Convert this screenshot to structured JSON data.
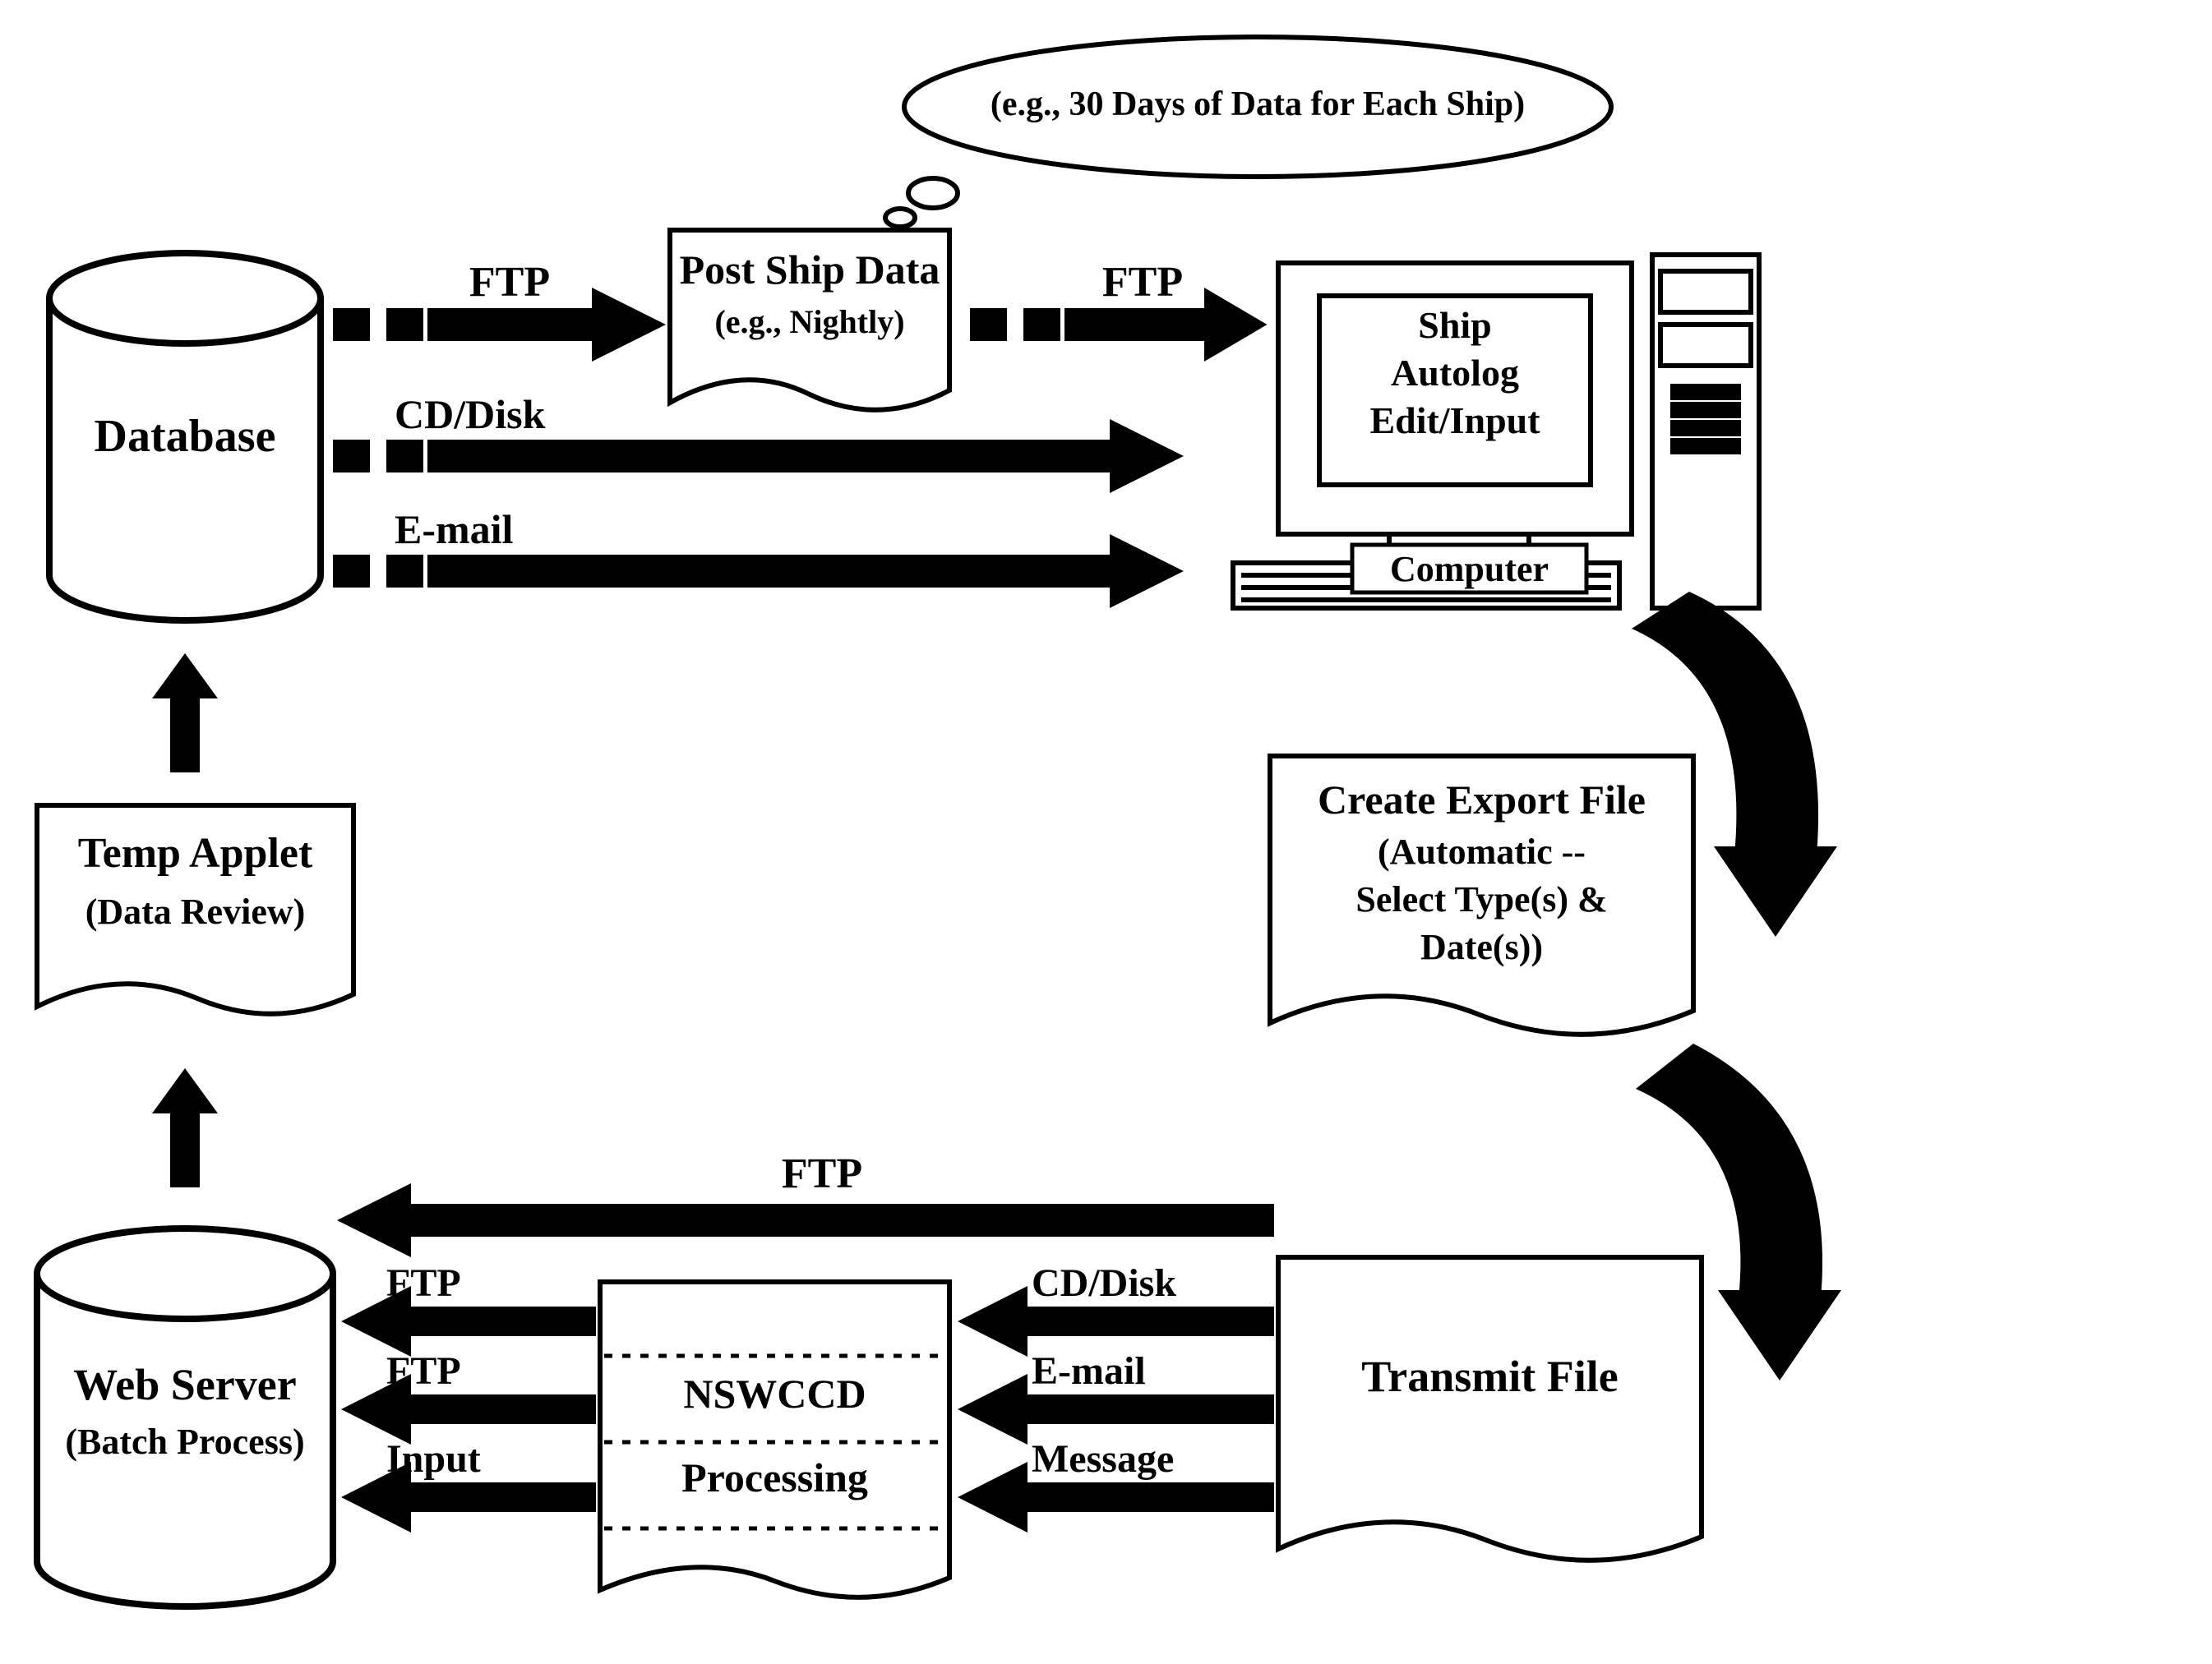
{
  "nodes": {
    "database": {
      "title": "Database"
    },
    "post_ship_data": {
      "title": "Post Ship Data",
      "subtitle": "(e.g., Nightly)"
    },
    "callout": {
      "text": "(e.g., 30 Days of Data for Each Ship)"
    },
    "ship_autolog": {
      "line1": "Ship",
      "line2": "Autolog",
      "line3": "Edit/Input"
    },
    "computer_label": {
      "text": "Computer"
    },
    "create_export": {
      "title": "Create Export  File",
      "line2": "(Automatic --",
      "line3": "Select Type(s) &",
      "line4": "Date(s))"
    },
    "transmit_file": {
      "title": "Transmit File"
    },
    "nswccd": {
      "line1": "NSWCCD",
      "line2": "Processing"
    },
    "web_server": {
      "title": "Web Server",
      "subtitle": "(Batch Process)"
    },
    "temp_applet": {
      "title": "Temp Applet",
      "subtitle": "(Data Review)"
    }
  },
  "edges": {
    "db_to_post_ftp": "FTP",
    "post_to_comp_ftp": "FTP",
    "db_to_comp_cd": "CD/Disk",
    "db_to_comp_email": "E-mail",
    "transmit_to_ws_ftp_top": "FTP",
    "transmit_to_nswccd_cd": "CD/Disk",
    "transmit_to_nswccd_email": "E-mail",
    "transmit_to_nswccd_msg": "Message",
    "nswccd_to_ws_ftp1": "FTP",
    "nswccd_to_ws_ftp2": "FTP",
    "nswccd_to_ws_input": "Input"
  }
}
